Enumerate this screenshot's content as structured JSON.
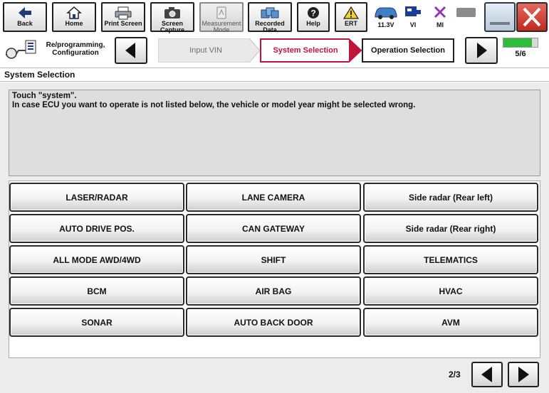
{
  "toolbar": {
    "back_label": "Back",
    "home_label": "Home",
    "print_label": "Print Screen",
    "capture_label_1": "Screen",
    "capture_label_2": "Capture",
    "measurement_label_1": "Measurement",
    "measurement_label_2": "Mode",
    "recorded_label_1": "Recorded",
    "recorded_label_2": "Data",
    "help_label": "Help",
    "ert_label": "ERT"
  },
  "status": {
    "voltage": "11.3V",
    "vi_label": "VI",
    "mi_label": "MI"
  },
  "nav": {
    "reprog_line1": "Re/programming,",
    "reprog_line2": "Configuration",
    "steps": [
      {
        "label": "Input VIN",
        "state": "done"
      },
      {
        "label": "System Selection",
        "state": "current"
      },
      {
        "label": "Operation Selection",
        "state": "next"
      }
    ],
    "progress_label": "5/6",
    "progress_fraction": 0.83
  },
  "section_title": "System Selection",
  "message": {
    "line1": "Touch \"system\".",
    "line2": "In case ECU you want to operate is not listed below, the vehicle or model year might be selected wrong."
  },
  "systems": [
    "LASER/RADAR",
    "LANE CAMERA",
    "Side radar (Rear left)",
    "AUTO DRIVE POS.",
    "CAN GATEWAY",
    "Side radar (Rear right)",
    "ALL MODE AWD/4WD",
    "SHIFT",
    "TELEMATICS",
    "BCM",
    "AIR BAG",
    "HVAC",
    "SONAR",
    "AUTO BACK DOOR",
    "AVM"
  ],
  "pager": {
    "page_label": "2/3"
  },
  "colors": {
    "current_step_border": "#c0143c",
    "progress_green": "#2ebd3a",
    "close_red": "#d9302c"
  }
}
